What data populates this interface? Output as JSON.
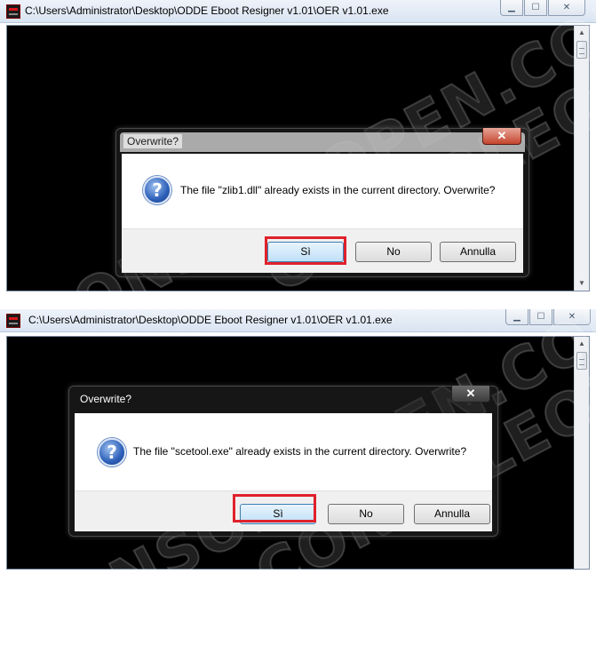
{
  "screenshots": [
    {
      "window": {
        "title": "C:\\Users\\Administrator\\Desktop\\ODDE Eboot Resigner v1.01\\OER v1.01.exe",
        "controls": {
          "minimize": "▁",
          "maximize": "☐",
          "close": "✕"
        }
      },
      "watermark": "CONSOLEOPEN.COM",
      "dialog": {
        "title": "Overwrite?",
        "icon": "question-icon",
        "message": "The file \"zlib1.dll\" already exists in the current directory. Overwrite?",
        "buttons": {
          "yes": "Sì",
          "no": "No",
          "cancel": "Annulla"
        },
        "highlighted_button": "yes"
      }
    },
    {
      "window": {
        "title": "C:\\Users\\Administrator\\Desktop\\ODDE Eboot Resigner v1.01\\OER v1.01.exe",
        "controls": {
          "minimize": "▁",
          "maximize": "☐",
          "close": "✕"
        }
      },
      "watermark": "CONSOLEOPEN.COM",
      "dialog": {
        "title": "Overwrite?",
        "icon": "question-icon",
        "message": "The file \"scetool.exe\" already exists in the current directory. Overwrite?",
        "buttons": {
          "yes": "Sì",
          "no": "No",
          "cancel": "Annulla"
        },
        "highlighted_button": "yes"
      }
    }
  ],
  "colors": {
    "console_bg": "#000000",
    "highlight": "#e0212b",
    "dialog_close_red": "#c4452d",
    "default_button": "#bfe0f7"
  }
}
